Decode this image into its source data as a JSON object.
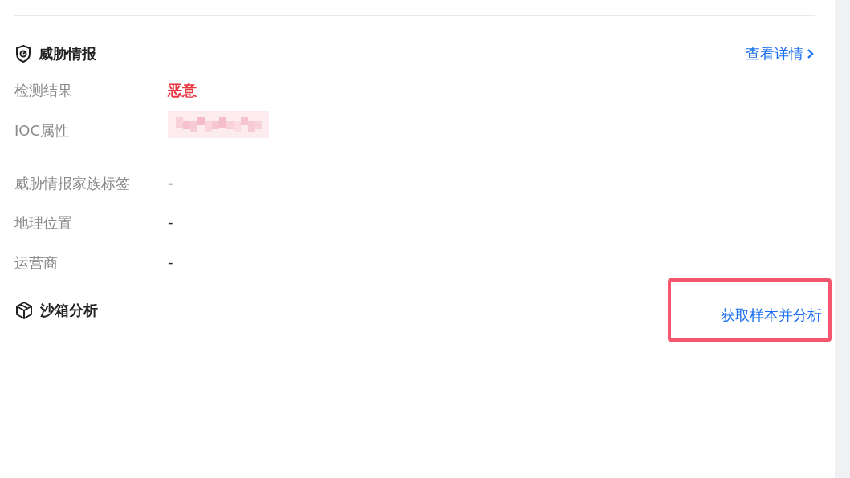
{
  "sections": [
    {
      "kind": "intel",
      "title": "威胁情报",
      "action": {
        "label": "查看详情",
        "highlighted": false
      },
      "rows": [
        {
          "label": "检测结果",
          "kind": "danger",
          "value": "恶意"
        },
        {
          "label": "IOC属性",
          "kind": "redacted"
        },
        {
          "label": "威胁情报家族标签",
          "kind": "text",
          "value": "-"
        },
        {
          "label": "地理位置",
          "kind": "text",
          "value": "-"
        },
        {
          "label": "运营商",
          "kind": "text",
          "value": "-"
        }
      ]
    },
    {
      "kind": "sandbox",
      "title": "沙箱分析",
      "action": {
        "label": "获取样本并分析",
        "highlighted": true
      }
    }
  ]
}
